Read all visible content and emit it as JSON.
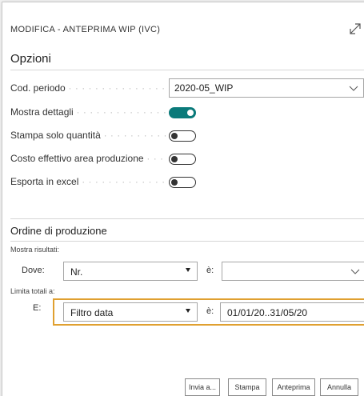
{
  "dialog": {
    "title": "MODIFICA - ANTEPRIMA WIP (IVC)"
  },
  "opzioni": {
    "heading": "Opzioni",
    "cod_periodo_label": "Cod. periodo",
    "cod_periodo_value": "2020-05_WIP",
    "mostra_dettagli_label": "Mostra dettagli",
    "mostra_dettagli_on": true,
    "stampa_quantita_label": "Stampa solo quantità",
    "stampa_quantita_on": false,
    "costo_effettivo_label": "Costo effettivo area produzione",
    "costo_effettivo_on": false,
    "esporta_excel_label": "Esporta in excel",
    "esporta_excel_on": false
  },
  "ordine": {
    "heading": "Ordine di produzione",
    "mostra_risultati": "Mostra risultati:",
    "dove_label": "Dove:",
    "dove_field": "Nr.",
    "e_label": "è:",
    "dove_value": "",
    "limita_totali": "Limita totali a:",
    "e_row_label": "E:",
    "filter_field": "Filtro data",
    "filter_value": "01/01/20..31/05/20"
  },
  "buttons": {
    "invia": "Invia a...",
    "stampa": "Stampa",
    "anteprima": "Anteprima",
    "annulla": "Annulla"
  },
  "colors": {
    "accent": "#0a7a7a",
    "highlight": "#e0a030"
  }
}
